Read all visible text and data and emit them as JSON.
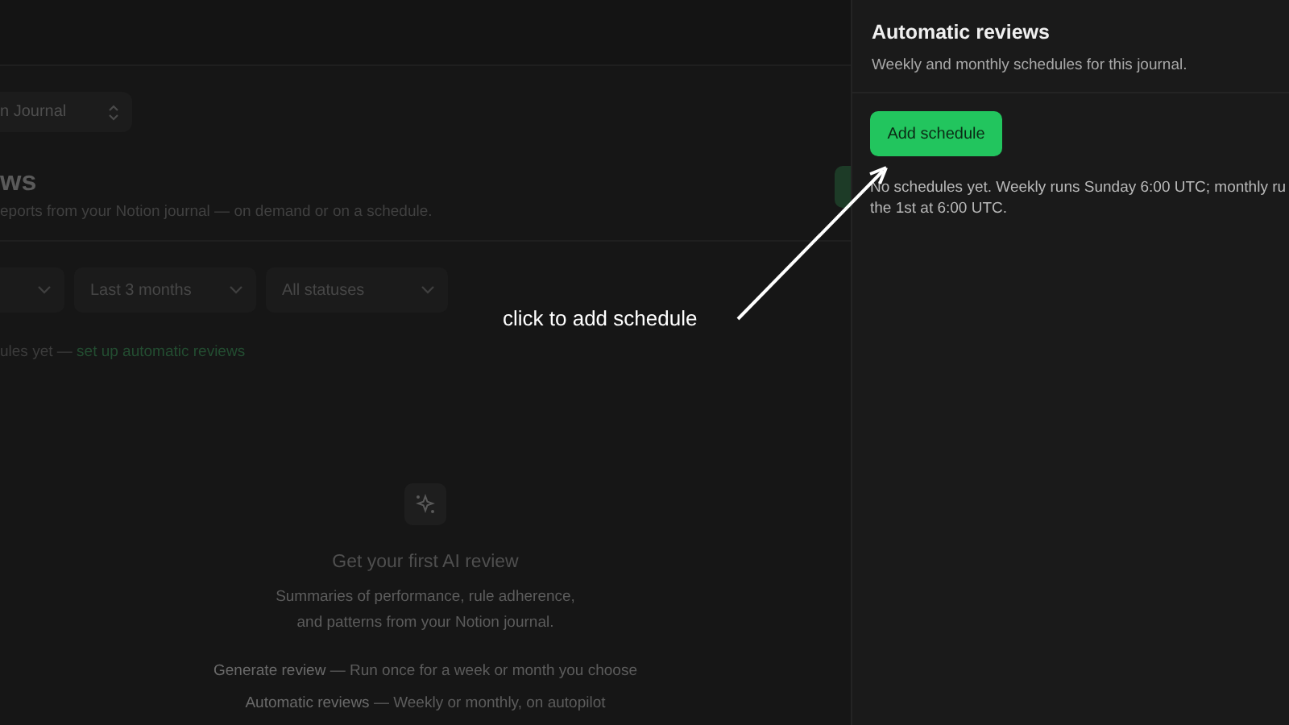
{
  "journal_selector": {
    "label": "n Journal"
  },
  "page": {
    "title": "ws",
    "subtitle": "eports from your Notion journal — on demand or on a schedule."
  },
  "filters": [
    {
      "kind": "partial"
    },
    {
      "kind": "select",
      "label": "Last 3 months"
    },
    {
      "kind": "select",
      "label": "All statuses"
    }
  ],
  "schedule_note": {
    "text": "ules yet — ",
    "link": "set up automatic reviews"
  },
  "empty_state": {
    "title": "Get your first AI review",
    "description": [
      "Summaries of performance, rule adherence,",
      "and patterns from your Notion journal."
    ],
    "features": [
      {
        "name": "Generate review",
        "text": " — Run once for a week or month you choose"
      },
      {
        "name": "Automatic reviews",
        "text": " — Weekly or monthly, on autopilot"
      }
    ]
  },
  "panel": {
    "title": "Automatic reviews",
    "subtitle": "Weekly and monthly schedules for this journal.",
    "button": "Add schedule",
    "note": [
      "No schedules yet. Weekly runs Sunday 6:00 UTC; monthly ru",
      "the 1st at 6:00 UTC."
    ]
  },
  "annotation": {
    "text": "click to add schedule"
  }
}
